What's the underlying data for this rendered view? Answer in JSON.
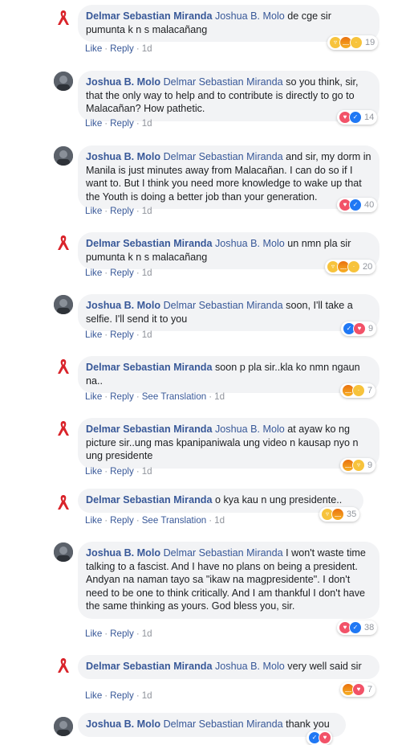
{
  "comments": [
    {
      "author": "Delmar Sebastian Miranda",
      "mention": "Joshua B. Molo",
      "text": "de cge sir pumunta k n s malacañang",
      "actions": {
        "like": "Like",
        "reply": "Reply",
        "translate": "",
        "time": "1d"
      },
      "reactions": [
        "haha",
        "angry",
        "sad"
      ],
      "count": "19",
      "avatar": "ribbon-icon"
    },
    {
      "author": "Joshua B. Molo",
      "mention": "Delmar Sebastian Miranda",
      "text": "so you think, sir, that the only way to help and to contribute is directly to go to Malacañan? How pathetic.",
      "actions": {
        "like": "Like",
        "reply": "Reply",
        "translate": "",
        "time": "1d"
      },
      "reactions": [
        "love",
        "like"
      ],
      "count": "14",
      "avatar": "profile-photo"
    },
    {
      "author": "Joshua B. Molo",
      "mention": "Delmar Sebastian Miranda",
      "text": "and sir, my dorm in Manila is just minutes away from Malacañan. I can do so if I want to. But I think you need more knowledge to wake up that the Youth is doing a better job than your generation.",
      "actions": {
        "like": "Like",
        "reply": "Reply",
        "translate": "",
        "time": "1d"
      },
      "reactions": [
        "love",
        "like"
      ],
      "count": "40",
      "avatar": "profile-photo"
    },
    {
      "author": "Delmar Sebastian Miranda",
      "mention": "Joshua B. Molo",
      "text": "un nmn pla sir pumunta k n s malacañang",
      "actions": {
        "like": "Like",
        "reply": "Reply",
        "translate": "",
        "time": "1d"
      },
      "reactions": [
        "haha",
        "angry",
        "sad"
      ],
      "count": "20",
      "avatar": "ribbon-icon"
    },
    {
      "author": "Joshua B. Molo",
      "mention": "Delmar Sebastian Miranda",
      "text": "soon, I'll take a selfie. I'll send it to you",
      "actions": {
        "like": "Like",
        "reply": "Reply",
        "translate": "",
        "time": "1d"
      },
      "reactions": [
        "like",
        "love"
      ],
      "count": "9",
      "avatar": "profile-photo"
    },
    {
      "author": "Delmar Sebastian Miranda",
      "mention": "",
      "text": "soon p pla sir..kla ko nmn ngaun na..",
      "actions": {
        "like": "Like",
        "reply": "Reply",
        "translate": "See Translation",
        "time": "1d"
      },
      "reactions": [
        "angry",
        "sad"
      ],
      "count": "7",
      "avatar": "ribbon-icon"
    },
    {
      "author": "Delmar Sebastian Miranda",
      "mention": "Joshua B. Molo",
      "text": "at ayaw ko ng picture sir..ung mas kpanipaniwala ung video n kausap nyo n ung presidente",
      "actions": {
        "like": "Like",
        "reply": "Reply",
        "translate": "",
        "time": "1d"
      },
      "reactions": [
        "angry",
        "haha"
      ],
      "count": "9",
      "avatar": "ribbon-icon"
    },
    {
      "author": "Delmar Sebastian Miranda",
      "mention": "",
      "text": "o kya kau n ung presidente..",
      "actions": {
        "like": "Like",
        "reply": "Reply",
        "translate": "See Translation",
        "time": "1d"
      },
      "reactions": [
        "haha",
        "angry"
      ],
      "count": "35",
      "avatar": "ribbon-icon"
    },
    {
      "author": "Joshua B. Molo",
      "mention": "Delmar Sebastian Miranda",
      "text": "I won't waste time talking to a fascist. And I have no plans on being a president. Andyan na naman tayo sa \"ikaw na magpresidente\". I don't need to be one to think critically. And I am thankful I don't have the same thinking as yours. God bless you, sir.",
      "actions": {
        "like": "Like",
        "reply": "Reply",
        "translate": "",
        "time": "1d"
      },
      "reactions": [
        "love",
        "like"
      ],
      "count": "38",
      "avatar": "profile-photo"
    },
    {
      "author": "Delmar Sebastian Miranda",
      "mention": "Joshua B. Molo",
      "text": "very well said sir",
      "actions": {
        "like": "Like",
        "reply": "Reply",
        "translate": "",
        "time": "1d"
      },
      "reactions": [
        "angry",
        "love"
      ],
      "count": "7",
      "avatar": "ribbon-icon"
    },
    {
      "author": "Joshua B. Molo",
      "mention": "Delmar Sebastian Miranda",
      "text": "thank you",
      "actions": {
        "like": "",
        "reply": "",
        "translate": "",
        "time": ""
      },
      "reactions": [
        "like",
        "love"
      ],
      "count": "",
      "avatar": "profile-photo"
    }
  ]
}
